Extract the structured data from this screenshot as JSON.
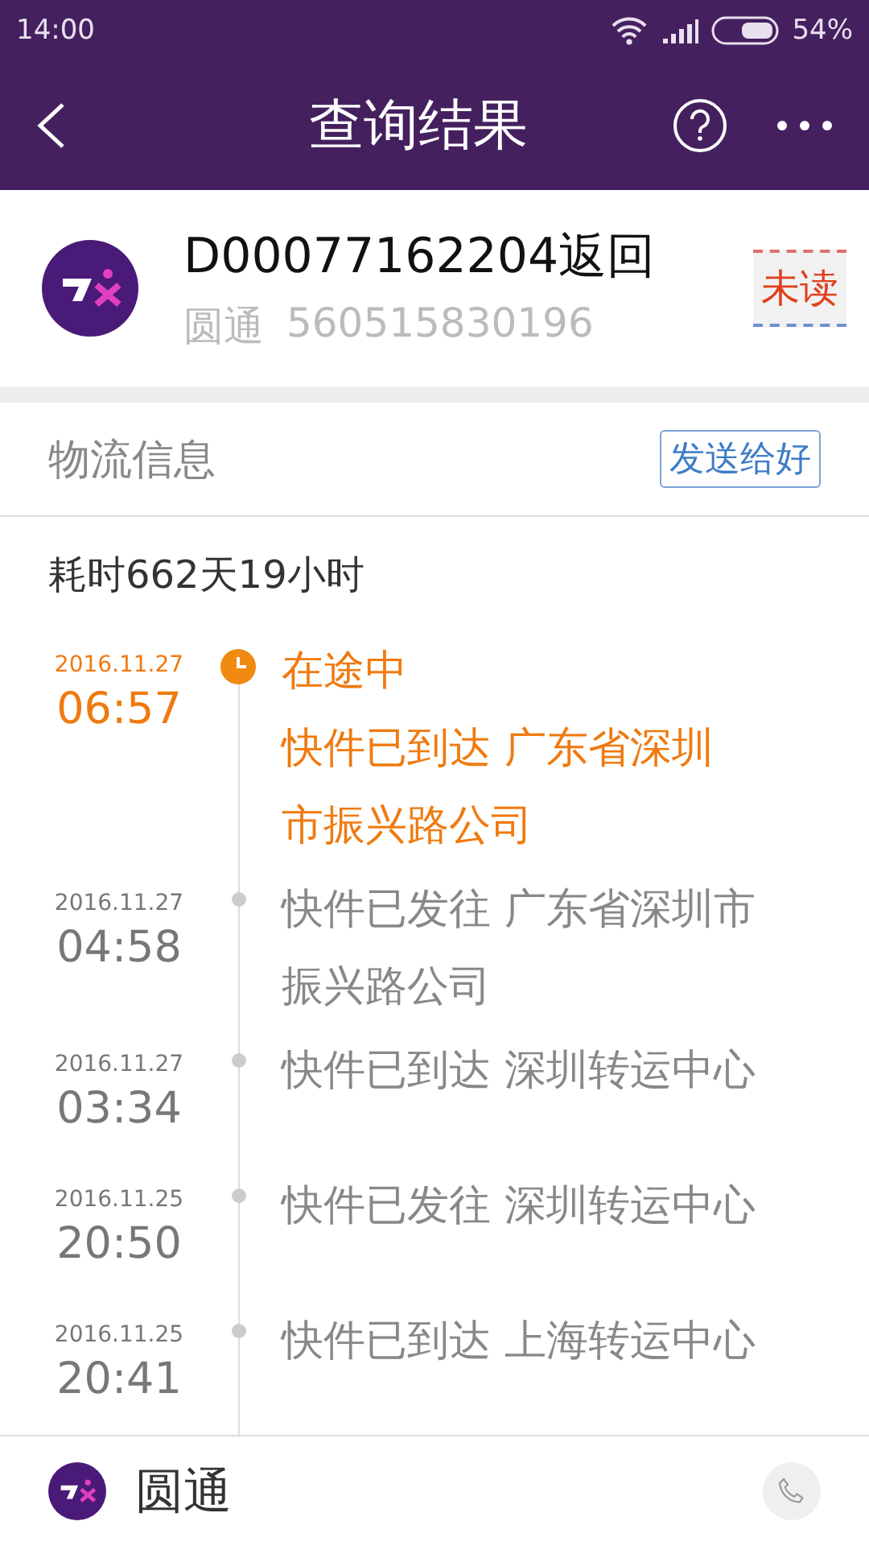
{
  "status_bar": {
    "time": "14:00",
    "battery": "54%"
  },
  "header": {
    "title": "查询结果"
  },
  "package": {
    "title": "D00077162204返回",
    "carrier": "圆通",
    "tracking_number": "560515830196",
    "badge": "未读"
  },
  "section": {
    "title": "物流信息",
    "share_button": "发送给好"
  },
  "duration": "耗时662天19小时",
  "events": [
    {
      "date": "2016.11.27",
      "time": "06:57",
      "current": true,
      "status": "在途中",
      "lines": [
        "快件已到达 广东省深圳",
        "市振兴路公司"
      ]
    },
    {
      "date": "2016.11.27",
      "time": "04:58",
      "current": false,
      "lines": [
        "快件已发往 广东省深圳市",
        "振兴路公司"
      ]
    },
    {
      "date": "2016.11.27",
      "time": "03:34",
      "current": false,
      "lines": [
        "快件已到达 深圳转运中心"
      ]
    },
    {
      "date": "2016.11.25",
      "time": "20:50",
      "current": false,
      "lines": [
        "快件已发往 深圳转运中心"
      ]
    },
    {
      "date": "2016.11.25",
      "time": "20:41",
      "current": false,
      "lines": [
        "快件已到达 上海转运中心"
      ]
    }
  ],
  "footer": {
    "carrier": "圆通"
  }
}
